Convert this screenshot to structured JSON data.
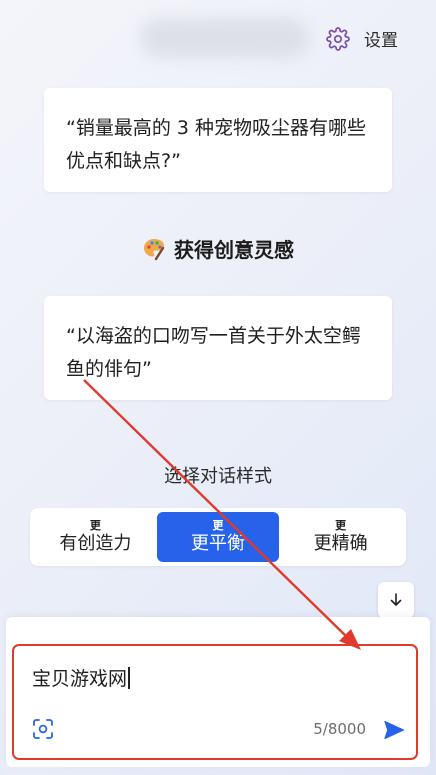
{
  "header": {
    "settings_label": "设置",
    "settings_icon": "gear-icon"
  },
  "suggestions": [
    {
      "text": "“销量最高的 3 种宠物吸尘器有哪些优点和缺点?”"
    },
    {
      "text": "“以海盗的口吻写一首关于外太空鳄鱼的俳句”"
    }
  ],
  "section": {
    "title": "获得创意灵感",
    "icon": "palette-icon"
  },
  "conversation_style": {
    "label": "选择对话样式",
    "options": [
      {
        "small": "更",
        "label": "有创造力"
      },
      {
        "small": "更",
        "label": "更平衡"
      },
      {
        "small": "更",
        "label": "更精确"
      }
    ],
    "selected_index": 1
  },
  "scroll_down_icon": "arrow-down-icon",
  "composer": {
    "value": "宝贝游戏网",
    "counter": "5/8000",
    "scan_icon": "visual-search-icon",
    "send_icon": "send-icon"
  },
  "colors": {
    "accent": "#2763ea",
    "annotation": "#e03a2c",
    "gear": "#7b4fa8"
  }
}
